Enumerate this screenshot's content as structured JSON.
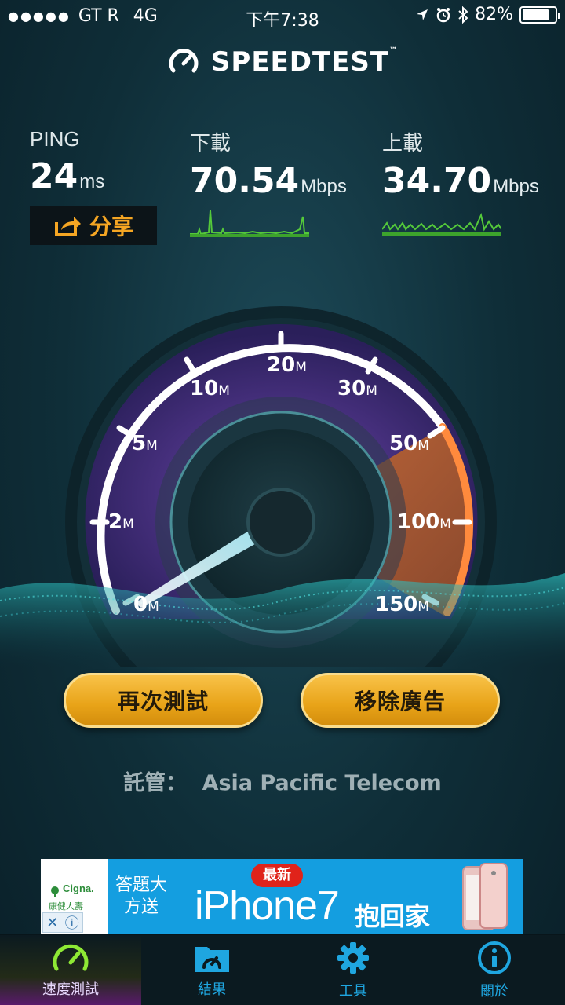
{
  "status": {
    "carrier": "GT R",
    "network": "4G",
    "time": "下午7:38",
    "battery": "82%",
    "battery_level": 0.82,
    "signal_dots": 5
  },
  "header": {
    "title": "SPEEDTEST",
    "tm": "™"
  },
  "stats": {
    "ping": {
      "label": "PING",
      "value": "24",
      "unit": "ms"
    },
    "download": {
      "label": "下載",
      "value": "70.54",
      "unit": "Mbps"
    },
    "upload": {
      "label": "上載",
      "value": "34.70",
      "unit": "Mbps"
    }
  },
  "share_label": "分享",
  "gauge": {
    "ticks": [
      {
        "num": "0",
        "unit": "M"
      },
      {
        "num": "2",
        "unit": "M"
      },
      {
        "num": "5",
        "unit": "M"
      },
      {
        "num": "10",
        "unit": "M"
      },
      {
        "num": "20",
        "unit": "M"
      },
      {
        "num": "30",
        "unit": "M"
      },
      {
        "num": "50",
        "unit": "M"
      },
      {
        "num": "100",
        "unit": "M"
      },
      {
        "num": "150",
        "unit": "M"
      }
    ]
  },
  "buttons": {
    "retest": "再次測試",
    "remove_ads": "移除廣告"
  },
  "host": {
    "label": "託管：",
    "name": "Asia Pacific Telecom"
  },
  "ad": {
    "brand": "Cigna.",
    "brand_sub": "康健人壽",
    "question": "答題大方送",
    "badge": "最新",
    "product": "iPhone7",
    "tagline": "抱回家"
  },
  "tabs": [
    {
      "label": "速度測試",
      "icon": "speedometer-icon",
      "active": true
    },
    {
      "label": "結果",
      "icon": "results-folder-icon",
      "active": false
    },
    {
      "label": "工具",
      "icon": "gear-icon",
      "active": false
    },
    {
      "label": "關於",
      "icon": "info-icon",
      "active": false
    }
  ]
}
